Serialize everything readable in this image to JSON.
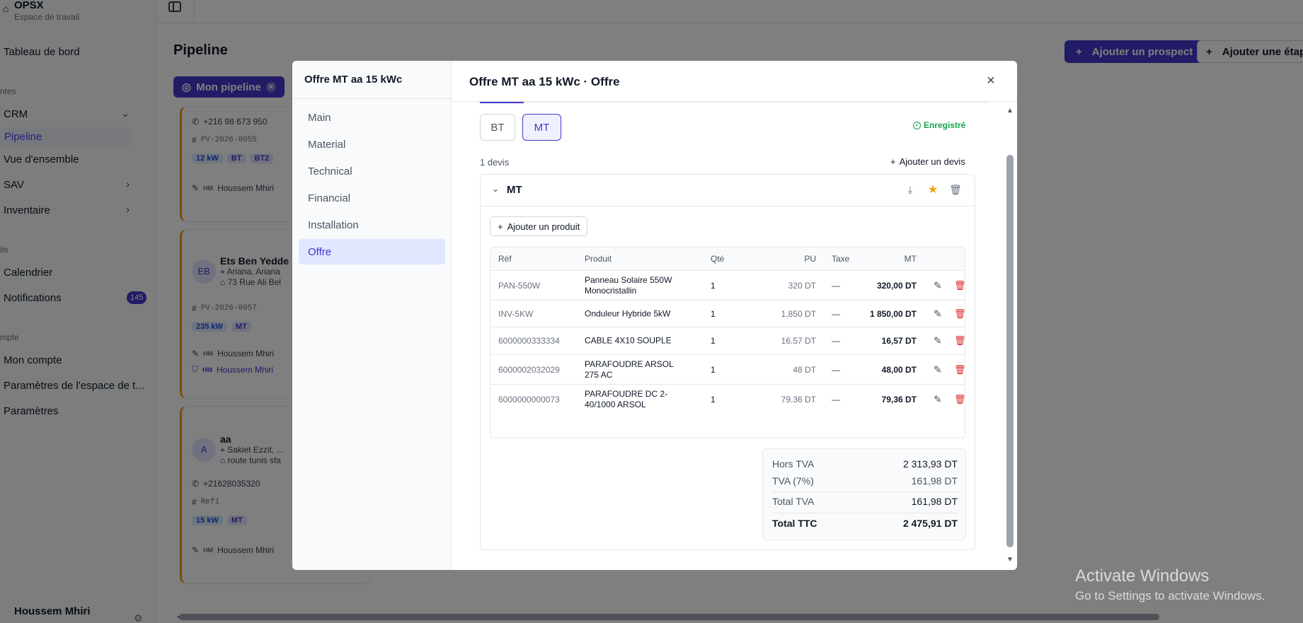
{
  "app": {
    "name": "OPSX",
    "workspace": "Espace de travail"
  },
  "sidebar": {
    "dashboard": "Tableau de bord",
    "section_sales": "ntes",
    "crm": "CRM",
    "pipeline": "Pipeline",
    "overview": "Vue d'ensemble",
    "sav": "SAV",
    "inventory": "Inventaire",
    "section_tools": "ils",
    "calendar": "Calendrier",
    "notifications": "Notifications",
    "notifications_count": "145",
    "section_account": "mpte",
    "my_account": "Mon compte",
    "workspace_settings": "Paramètres de l'espace de t...",
    "settings": "Paramètres",
    "user": "Houssem Mhiri"
  },
  "page": {
    "title": "Pipeline",
    "filter_chip": "Mon pipeline",
    "add_prospect": "Ajouter un prospect",
    "add_stage": "Ajouter une étape"
  },
  "cards": [
    {
      "phone": "+216 98 673 950",
      "ref": "PV-2026-0055",
      "kw": "12 kW",
      "tags": [
        "BT",
        "BT2"
      ],
      "owner_initials": "HM",
      "owner": "Houssem Mhiri"
    },
    {
      "initials": "EB",
      "name": "Ets Ben Yedde",
      "location": "Ariana, Ariana",
      "address": "73 Rue Ali Bel",
      "ref": "PV-2026-0057",
      "kw": "235 kW",
      "tags": [
        "MT"
      ],
      "owner_initials": "HM",
      "owner": "Houssem Mhiri",
      "owner2": "Houssem Mhiri"
    },
    {
      "initials": "A",
      "name": "aa",
      "location": "Sakiet Ezzit, ...",
      "address": "route tunis sfa",
      "phone": "+21628035320",
      "ref": "Ref1",
      "kw": "15 kW",
      "tags": [
        "MT"
      ],
      "owner_initials": "HM",
      "owner": "Houssem Mhiri"
    }
  ],
  "modal": {
    "nav_title": "Offre MT aa 15 kWc",
    "nav_items": [
      "Main",
      "Material",
      "Technical",
      "Financial",
      "Installation",
      "Offre"
    ],
    "active_nav": "Offre",
    "header_title": "Offre MT aa 15 kWc · Offre",
    "close": "×",
    "segments": [
      "BT",
      "MT"
    ],
    "active_segment": "MT",
    "saved_status": "Enregistré",
    "quote_count": "1 devis",
    "add_quote": "Ajouter un devis",
    "quote": {
      "name": "MT",
      "add_product": "Ajouter un produit",
      "columns": [
        "Réf",
        "Produit",
        "Qté",
        "PU",
        "Taxe",
        "MT"
      ],
      "rows": [
        {
          "ref": "PAN-550W",
          "product": "Panneau Solaire 550W Monocristallin",
          "qty": "1",
          "pu": "320 DT",
          "tax": "—",
          "mt": "320,00 DT"
        },
        {
          "ref": "INV-5KW",
          "product": "Onduleur Hybride 5kW",
          "qty": "1",
          "pu": "1,850 DT",
          "tax": "—",
          "mt": "1 850,00 DT"
        },
        {
          "ref": "6000000333334",
          "product": "CABLE 4X10 SOUPLE",
          "qty": "1",
          "pu": "16.57 DT",
          "tax": "—",
          "mt": "16,57 DT"
        },
        {
          "ref": "6000002032029",
          "product": "PARAFOUDRE ARSOL 275 AC",
          "qty": "1",
          "pu": "48 DT",
          "tax": "—",
          "mt": "48,00 DT"
        },
        {
          "ref": "6000000000073",
          "product": "PARAFOUDRE DC 2-40/1000 ARSOL",
          "qty": "1",
          "pu": "79.36 DT",
          "tax": "—",
          "mt": "79,36 DT"
        }
      ],
      "totals": [
        {
          "label": "Hors TVA",
          "value": "2 313,93 DT"
        },
        {
          "label": "TVA (7%)",
          "value": "161,98 DT"
        },
        {
          "label": "Total TVA",
          "value": "161,98 DT"
        },
        {
          "label": "Total TTC",
          "value": "2 475,91 DT"
        }
      ]
    }
  },
  "windows_watermark": {
    "title": "Activate Windows",
    "subtitle": "Go to Settings to activate Windows."
  },
  "colors": {
    "accent": "#4338ca",
    "saved": "#16a34a",
    "danger": "#dc2626",
    "star": "#f59e0b",
    "card_border": "#f59e0b"
  },
  "icons": [
    "menu-icon",
    "close-icon",
    "plus-icon",
    "check-circle-icon",
    "chevron-down-icon",
    "download-icon",
    "star-icon",
    "trash-icon",
    "pencil-icon",
    "phone-icon",
    "hash-icon",
    "bolt-icon",
    "map-pin-icon",
    "home-icon",
    "gear-icon"
  ]
}
